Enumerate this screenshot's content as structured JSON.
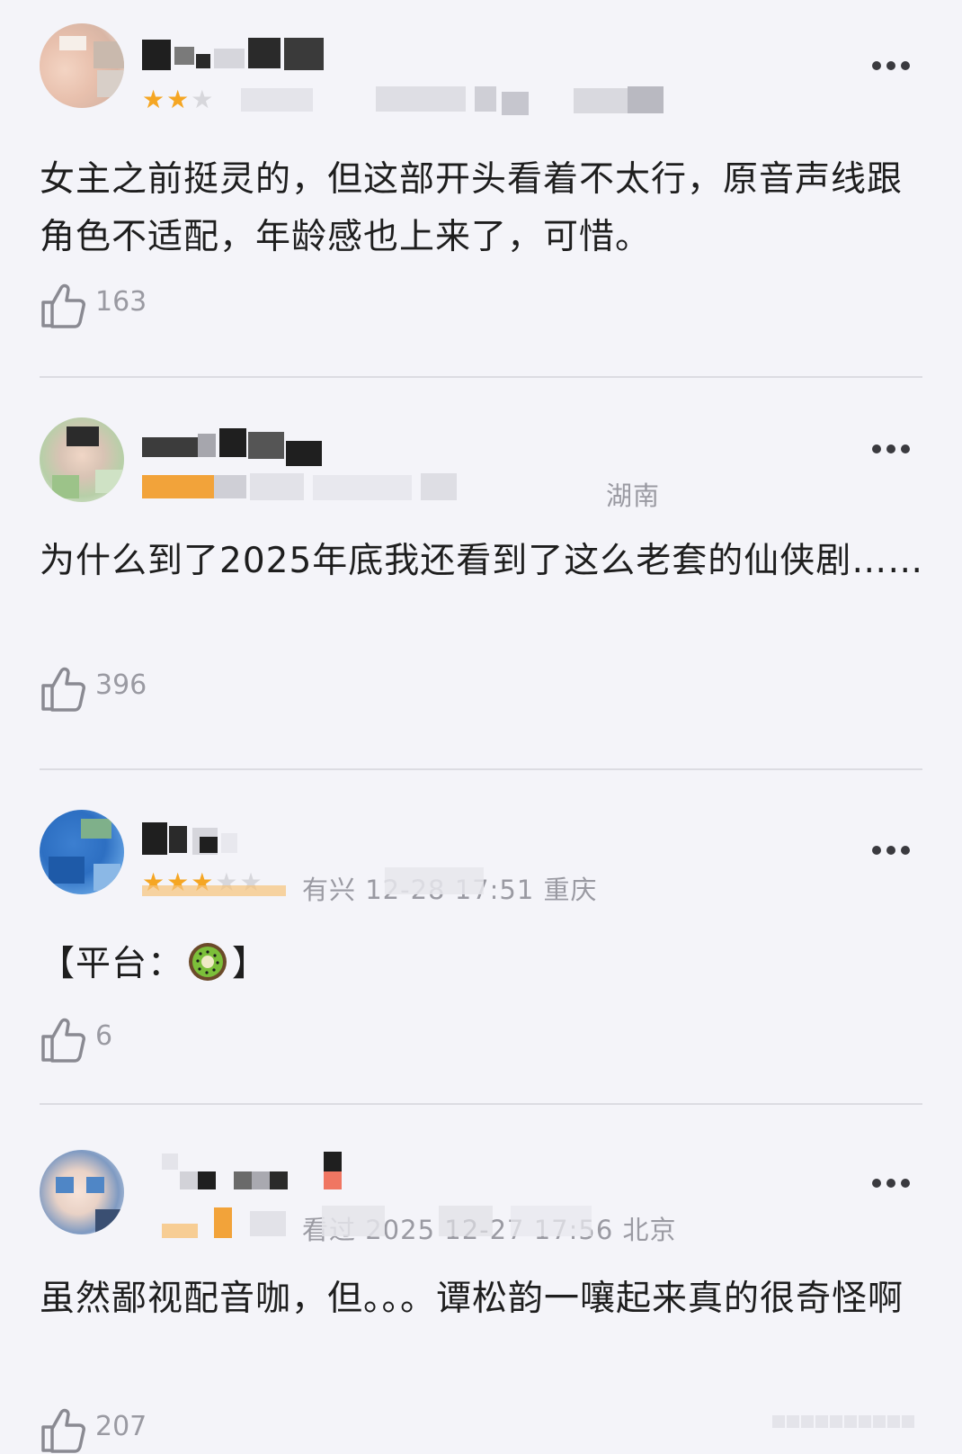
{
  "comments": [
    {
      "username_visible": "猪 偶月己",
      "rating_stars": 2,
      "rating_max": 5,
      "meta_visible": "17省 20 12-27 14:04 天津",
      "text": "女主之前挺灵的，但这部开头看着不太行，原音声线跟角色不适配，年龄感也上来了，可惜。",
      "likes": "163"
    },
    {
      "username_visible": "籼籼 訒音",
      "rating_stars": null,
      "meta_visible": "湖南",
      "text": "为什么到了2025年底我还看到了这么老套的仙侠剧……",
      "likes": "396"
    },
    {
      "username_visible": "9C",
      "rating_stars": 3,
      "rating_max": 5,
      "meta_visible": "有兴 12-28 17:51 重庆",
      "text_before_emoji": "【平台：",
      "emoji": "kiwi",
      "text_after_emoji": "】",
      "likes": "6"
    },
    {
      "username_visible": "",
      "rating_stars": null,
      "meta_visible": "看过 2025 12-27 17:56 北京",
      "text": "虽然鄙视配音咖，但。。。谭松韵一嚷起来真的很奇怪啊",
      "likes": "207"
    }
  ],
  "icons": {
    "more": "more-dots-icon",
    "like": "thumbs-up-icon",
    "emoji": "kiwi-emoji-icon"
  },
  "colors": {
    "background": "#f4f4f9",
    "star_on": "#f5a623",
    "meta_text": "#9a9aa2",
    "divider": "#dcdce2"
  }
}
